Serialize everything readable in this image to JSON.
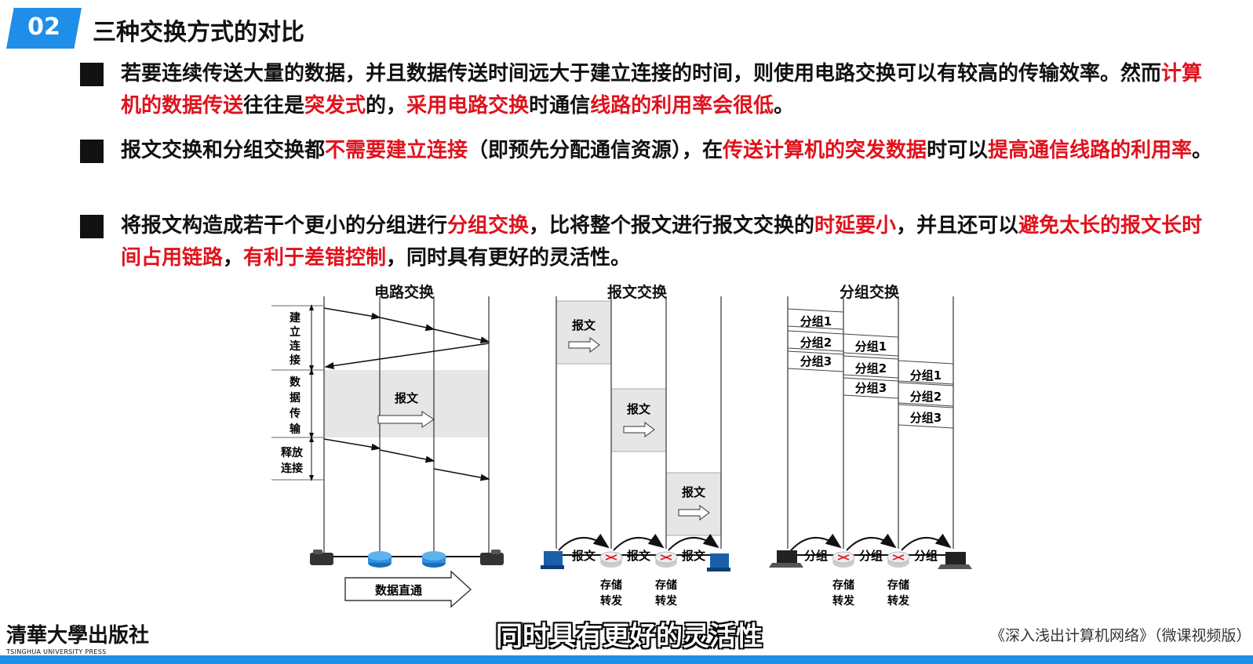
{
  "header": {
    "number": "02",
    "title": "三种交换方式的对比"
  },
  "bullets": [
    {
      "segments": [
        {
          "text": "若要连续传送大量的数据，并且数据传送时间远大于建立连接的时间，则使用电路交换可以有较高的传输效率。然而",
          "red": false
        },
        {
          "text": "计算机的数据传送",
          "red": true
        },
        {
          "text": "往往是",
          "red": false
        },
        {
          "text": "突发式",
          "red": true
        },
        {
          "text": "的，",
          "red": false
        },
        {
          "text": "采用电路交换",
          "red": true
        },
        {
          "text": "时通信",
          "red": false
        },
        {
          "text": "线路的利用率会很低",
          "red": true
        },
        {
          "text": "。",
          "red": false
        }
      ]
    },
    {
      "segments": [
        {
          "text": "报文交换和分组交换都",
          "red": false
        },
        {
          "text": "不需要建立连接",
          "red": true
        },
        {
          "text": "（即预先分配通信资源），在",
          "red": false
        },
        {
          "text": "传送计算机的突发数据",
          "red": true
        },
        {
          "text": "时可以",
          "red": false
        },
        {
          "text": "提高通信线路的利用率",
          "red": true
        },
        {
          "text": "。",
          "red": false
        }
      ]
    },
    {
      "segments": [
        {
          "text": "将报文构造成若干个更小的分组进行",
          "red": false
        },
        {
          "text": "分组交换",
          "red": true
        },
        {
          "text": "，比将整个报文进行报文交换的",
          "red": false
        },
        {
          "text": "时延要小",
          "red": true
        },
        {
          "text": "，并且还可以",
          "red": false
        },
        {
          "text": "避免太长的报文长时间占用链路",
          "red": true
        },
        {
          "text": "，",
          "red": false
        },
        {
          "text": "有利于差错控制",
          "red": true
        },
        {
          "text": "，同时具有更好的灵活性。",
          "red": false
        }
      ]
    }
  ],
  "diagrams": {
    "circuit": {
      "title": "电路交换",
      "phase_setup": [
        "建",
        "立",
        "连",
        "接"
      ],
      "phase_data": [
        "数",
        "据",
        "传",
        "输"
      ],
      "phase_release": [
        "释放",
        "连接"
      ],
      "message_label": "报文",
      "direct_label": "数据直通"
    },
    "message": {
      "title": "报文交换",
      "message_label": "报文",
      "store_forward": [
        "存储",
        "转发"
      ]
    },
    "packet": {
      "title": "分组交换",
      "packet_labels": [
        "分组1",
        "分组2",
        "分组3"
      ],
      "link_label": "分组",
      "store_forward": [
        "存储",
        "转发"
      ]
    }
  },
  "subtitle_caption": "同时具有更好的灵活性",
  "publisher": {
    "name_cn": "清華大學出版社",
    "name_en": "TSINGHUA UNIVERSITY PRESS"
  },
  "book_title": "《深入浅出计算机网络》（微课视频版）",
  "colors": {
    "accent": "#1f8ee8",
    "highlight": "#e0121d"
  }
}
